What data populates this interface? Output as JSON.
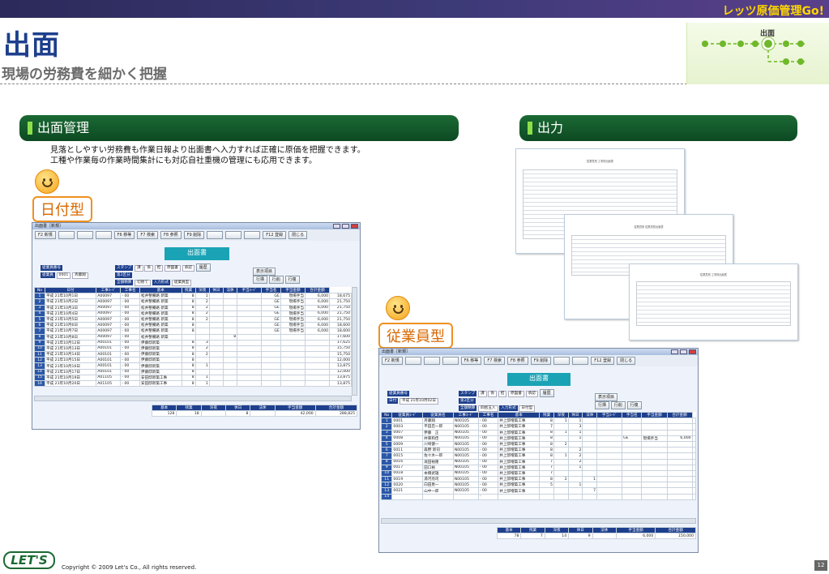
{
  "header": {
    "brand": "レッツ原価管理Go!",
    "title": "出面",
    "subtitle": "現場の労務費を細かく把握"
  },
  "flow": {
    "label": "出面"
  },
  "sections": {
    "left": "出面管理",
    "right": "出力"
  },
  "description": [
    "見落としやすい労務費も作業日報より出面書へ入力すれば正確に原価を把握できます。",
    "工種や作業毎の作業時間集計にも対応自社重機の管理にも応用できます。"
  ],
  "tags": {
    "date_type": "日付型",
    "employee_type": "従業員型"
  },
  "win1": {
    "title": "出面書［新規］",
    "toolbar": [
      "F2 新規",
      "F6 移等",
      "F7 検索",
      "F8 参照",
      "F9 削除",
      "F12 登録",
      "閉じる"
    ],
    "form_title": "出面書",
    "labels": {
      "emp_no": "従業員番号",
      "emp": "従業員",
      "emp_code": "0001",
      "emp_name": "斉藤翔",
      "stamp": "スタンプ",
      "stamp_vals": [
        "課",
        "係",
        "担"
      ],
      "seal": "原図書",
      "check": "承認",
      "ok": "履歴",
      "display": "表示項目",
      "dept": "第2区分",
      "kind": "全額精算",
      "kind_val": "切替て",
      "input_fmt": "入力形式",
      "input_val": "従業員型",
      "row_btns": [
        "行挿",
        "行削",
        "行複"
      ]
    },
    "columns": [
      "No",
      "日付",
      "工事ｺｰﾄﾞ",
      "工事名",
      "基本",
      "残業",
      "深夜",
      "休日",
      "法休",
      "手当ｺｰﾄﾞ",
      "手当名",
      "手当金額",
      "合計金額"
    ],
    "rows": [
      [
        "1",
        "平成 21年10月1日",
        "A00097",
        "- 00",
        "松井整備路 新築",
        "8",
        "1",
        "",
        "",
        "",
        "GE",
        "現場手当",
        "6,000",
        "18,675"
      ],
      [
        "2",
        "平成 21年10月2日",
        "A00097",
        "- 00",
        "松井整備路 新築",
        "8",
        "2",
        "",
        "",
        "",
        "GE",
        "現場手当",
        "6,000",
        "21,750"
      ],
      [
        "3",
        "平成 21年10月3日",
        "A00097",
        "- 00",
        "松井整備路 新築",
        "8",
        "2",
        "",
        "",
        "",
        "GE",
        "現場手当",
        "6,000",
        "21,750"
      ],
      [
        "4",
        "平成 21年10月4日",
        "A00097",
        "- 00",
        "松井整備路 新築",
        "8",
        "2",
        "",
        "",
        "",
        "GE",
        "現場手当",
        "6,000",
        "21,750"
      ],
      [
        "5",
        "平成 21年10月5日",
        "A00097",
        "- 00",
        "松井整備路 新築",
        "8",
        "2",
        "",
        "",
        "",
        "GE",
        "現場手当",
        "6,000",
        "21,750"
      ],
      [
        "6",
        "平成 21年10月6日",
        "A00097",
        "- 00",
        "松井整備路 新築",
        "8",
        "",
        "",
        "",
        "",
        "GE",
        "現場手当",
        "6,000",
        "18,600"
      ],
      [
        "7",
        "平成 21年10月7日",
        "A00097",
        "- 00",
        "松井整備路 新築",
        "8",
        "",
        "",
        "",
        "",
        "GE",
        "現場手当",
        "6,000",
        "18,600"
      ],
      [
        "8",
        "平成 21年10月8日",
        "A00097",
        "- 00",
        "松井整備路 新築",
        "",
        "",
        "",
        "8",
        "",
        "",
        "",
        "",
        "17,600"
      ],
      [
        "9",
        "平成 21年10月12日",
        "A00101",
        "- 00",
        "伊藤邸新築",
        "8",
        "3",
        "",
        "",
        "",
        "",
        "",
        "",
        "17,625"
      ],
      [
        "10",
        "平成 21年10月13日",
        "A00101",
        "- 00",
        "伊藤邸新築",
        "8",
        "2",
        "",
        "",
        "",
        "",
        "",
        "",
        "15,750"
      ],
      [
        "11",
        "平成 21年10月14日",
        "A00101",
        "- 00",
        "伊藤邸新築",
        "8",
        "2",
        "",
        "",
        "",
        "",
        "",
        "",
        "15,750"
      ],
      [
        "12",
        "平成 21年10月15日",
        "A00101",
        "- 00",
        "伊藤邸新築",
        "8",
        "",
        "",
        "",
        "",
        "",
        "",
        "",
        "12,000"
      ],
      [
        "13",
        "平成 21年10月16日",
        "A00101",
        "- 00",
        "伊藤邸新築",
        "8",
        "1",
        "",
        "",
        "",
        "",
        "",
        "",
        "13,875"
      ],
      [
        "14",
        "平成 21年10月17日",
        "A00101",
        "- 00",
        "伊藤邸新築",
        "8",
        "",
        "",
        "",
        "",
        "",
        "",
        "",
        "12,000"
      ],
      [
        "15",
        "平成 21年10月19日",
        "A01105",
        "- 00",
        "安田邸新築工事",
        "8",
        "1",
        "",
        "",
        "",
        "",
        "",
        "",
        "13,875"
      ],
      [
        "16",
        "平成 21年10月20日",
        "A01105",
        "- 00",
        "安田邸新築工事",
        "8",
        "1",
        "",
        "",
        "",
        "",
        "",
        "",
        "13,875"
      ]
    ],
    "footer_headers": [
      "基本",
      "残業",
      "深夜",
      "休日",
      "法休",
      "手当金額",
      "合計金額"
    ],
    "footer_values": [
      "128",
      "18",
      "",
      "8",
      "",
      "42,000",
      "288,825"
    ]
  },
  "win2": {
    "title": "出面書［新規］",
    "toolbar": [
      "F2 新規",
      "F6 移等",
      "F7 検索",
      "F8 参照",
      "F9 削除",
      "F12 登録",
      "閉じる"
    ],
    "form_title": "出面書",
    "labels": {
      "emp_no": "従業員番号",
      "date": "日付",
      "date_val": "平成 21年10月02日",
      "stamp": "スタンプ",
      "stamp_vals": [
        "課",
        "係",
        "担"
      ],
      "seal": "原図書",
      "check": "承認",
      "ok": "履歴",
      "display": "表示項目",
      "dept": "第2区分",
      "kind": "全額精算",
      "kind_val": "四捨五入",
      "input_fmt": "入力形式",
      "input_val": "日付型",
      "row_btns": [
        "行挿",
        "行削",
        "行複"
      ]
    },
    "columns": [
      "No",
      "従業員ｺｰﾄﾞ",
      "従業員名",
      "工事ｺｰﾄﾞ",
      "工事名",
      "基本",
      "残業",
      "深夜",
      "休日",
      "法休",
      "手当ｺｰﾄﾞ",
      "手当名",
      "手当金額",
      "合計金額"
    ],
    "rows": [
      [
        "1",
        "0001",
        "斉藤翔",
        "N00105",
        "- 00",
        "井上邸増築工事",
        "8",
        "1",
        "1",
        "",
        "",
        "",
        "",
        "",
        ""
      ],
      [
        "2",
        "0003",
        "平田忠一郎",
        "N00105",
        "- 00",
        "井上邸増築工事",
        "7",
        "",
        "3",
        "",
        "",
        "",
        "",
        "",
        ""
      ],
      [
        "3",
        "0007",
        "伊藤　正",
        "N00105",
        "- 00",
        "井上邸増築工事",
        "8",
        "1",
        "1",
        "",
        "",
        "",
        "",
        "",
        ""
      ],
      [
        "4",
        "0008",
        "井東和佳",
        "N00105",
        "- 00",
        "井上邸増築工事",
        "8",
        "",
        "1",
        "",
        "",
        "GE",
        "現場手当",
        "6,000",
        ""
      ],
      [
        "5",
        "0009",
        "川崎健一",
        "N00105",
        "- 00",
        "井上邸増築工事",
        "8",
        "2",
        "",
        "",
        "",
        "",
        "",
        "",
        ""
      ],
      [
        "6",
        "0011",
        "森野 新司",
        "N00105",
        "- 00",
        "井上邸増築工事",
        "8",
        "",
        "2",
        "",
        "",
        "",
        "",
        "",
        ""
      ],
      [
        "7",
        "0015",
        "佐々木一郎",
        "N00105",
        "- 00",
        "井上邸増築工事",
        "8",
        "1",
        "2",
        "",
        "",
        "",
        "",
        "",
        ""
      ],
      [
        "8",
        "0016",
        "滝田裕隆",
        "N00105",
        "- 00",
        "井上邸増築工事",
        "7",
        "",
        "2",
        "",
        "",
        "",
        "",
        "",
        ""
      ],
      [
        "9",
        "0017",
        "田口裕",
        "N00105",
        "- 00",
        "井上邸増築工事",
        "7",
        "",
        "1",
        "",
        "",
        "",
        "",
        "",
        ""
      ],
      [
        "10",
        "0018",
        "本橋武雄",
        "N00105",
        "- 00",
        "井上邸増築工事",
        "7",
        "",
        "",
        "",
        "",
        "",
        "",
        "",
        ""
      ],
      [
        "11",
        "0019",
        "湯河亮司",
        "N00105",
        "- 00",
        "井上邸増築工事",
        "8",
        "2",
        "",
        "1",
        "",
        "",
        "",
        "",
        ""
      ],
      [
        "12",
        "0020",
        "向田恵一",
        "N00105",
        "- 00",
        "井上邸増築工事",
        "5",
        "",
        "1",
        "",
        "",
        "",
        "",
        "",
        ""
      ],
      [
        "13",
        "0021",
        "山中一郎",
        "N00105",
        "- 00",
        "井上邸増築工事",
        "",
        "",
        "",
        "7",
        "",
        "",
        "",
        "",
        ""
      ],
      [
        "14",
        "",
        "",
        "",
        "-",
        "",
        "",
        "",
        "",
        "",
        "",
        "",
        "",
        "",
        ""
      ]
    ],
    "footer_headers": [
      "基本",
      "残業",
      "深夜",
      "休日",
      "法休",
      "手当金額",
      "合計金額"
    ],
    "footer_values": [
      "78",
      "7",
      "14",
      "9",
      "",
      "6,000",
      "150,000"
    ]
  },
  "printouts": [
    "従業員別 工事別出面表",
    "従業員別 従業員別出面表",
    "従業員別 工事別出面表"
  ],
  "footer": {
    "logo": "LET'S",
    "copyright": "Copyright © 2009 Let's Co., All rights reserved.",
    "page": "12"
  }
}
